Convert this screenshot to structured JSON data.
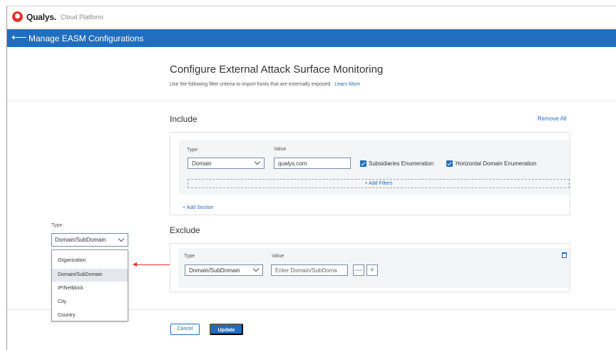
{
  "app": {
    "brand": "Qualys.",
    "brand_sub": "Cloud Platform"
  },
  "header": {
    "back_icon": "arrow-left-icon",
    "title": "Manage EASM Configurations"
  },
  "main": {
    "title": "Configure External Attack Surface Monitoring",
    "subtitle": "Use the following filter criteria to import hosts that are externally exposed.",
    "learn_more": "Learn More"
  },
  "include": {
    "title": "Include",
    "remove_all": "Remove All",
    "type_label": "Type",
    "value_label": "Value",
    "type_value": "Domain",
    "value_value": "qualys.com",
    "subsidiaries_label": "Subsidiaries Enumeration",
    "horizontal_label": "Horizontal Domain Enumeration",
    "add_filters": "+ Add Filters",
    "add_section": "+ Add Section"
  },
  "exclude": {
    "title": "Exclude",
    "type_label": "Type",
    "value_label": "Value",
    "type_value": "Domain/SubDomain",
    "value_placeholder": "Enter Domain/SubDoma",
    "minus": "—",
    "plus": "+"
  },
  "footer": {
    "cancel": "Cancel",
    "update": "Update"
  },
  "dropdown": {
    "label": "Type",
    "selected": "Domain/SubDomain",
    "options": [
      "Organization",
      "Domain/SubDomain",
      "IP/Netblock",
      "City",
      "Country"
    ]
  },
  "colors": {
    "accent": "#1f6ebf",
    "brand_red": "#e4322b"
  }
}
